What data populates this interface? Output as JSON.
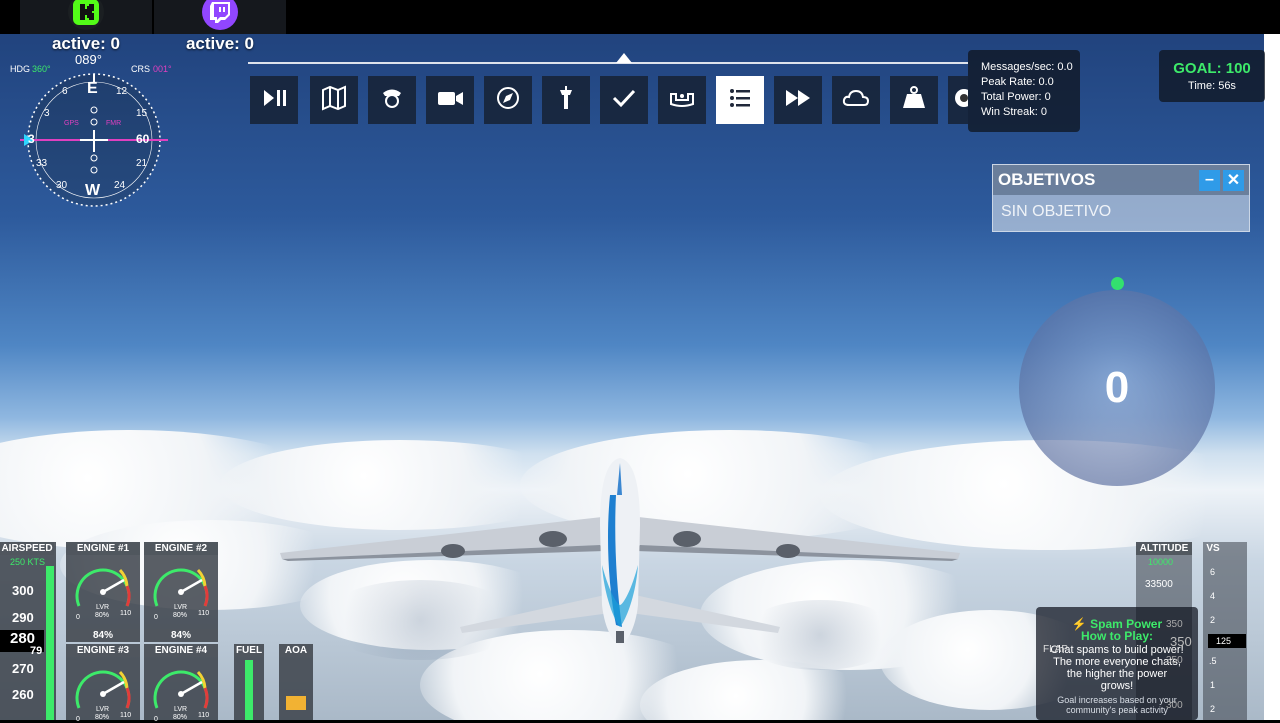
{
  "platforms": [
    {
      "name": "kick",
      "active_label": "active: 0",
      "color": "#53fc18"
    },
    {
      "name": "twitch",
      "active_label": "active: 0",
      "color": "#9146ff"
    }
  ],
  "toolbar": {
    "buttons": [
      {
        "icon": "play-pause-icon",
        "active": false
      },
      {
        "icon": "map-icon",
        "active": false
      },
      {
        "icon": "pilot-icon",
        "active": false
      },
      {
        "icon": "camera-icon",
        "active": false
      },
      {
        "icon": "compass-icon",
        "active": false
      },
      {
        "icon": "tower-icon",
        "active": false
      },
      {
        "icon": "checkmark-icon",
        "active": false
      },
      {
        "icon": "controls-icon",
        "active": false
      },
      {
        "icon": "list-icon",
        "active": true
      },
      {
        "icon": "fast-forward-icon",
        "active": false
      },
      {
        "icon": "weather-cloud-icon",
        "active": false
      },
      {
        "icon": "weight-icon",
        "active": false
      },
      {
        "icon": "gear-icon",
        "active": false
      }
    ]
  },
  "stats": {
    "messages": "Messages/sec: 0.0",
    "peak": "Peak Rate: 0.0",
    "power": "Total Power: 0",
    "streak": "Win Streak: 0"
  },
  "goal": {
    "title": "GOAL: 100",
    "time": "Time: 56s"
  },
  "objectives": {
    "title": "OBJETIVOS",
    "minimize": "–",
    "close": "✕",
    "empty": "SIN OBJETIVO"
  },
  "power_value": "0",
  "spam": {
    "title": "Spam Power",
    "subtitle": "How to Play:",
    "body": "Chat spams to build power! The more everyone chats, the higher the power grows!",
    "footer": "Goal increases based on your community's peak activity"
  },
  "compass": {
    "hdg_label": "HDG",
    "hdg_value": "360°",
    "crs_label": "CRS",
    "crs_value": "001°",
    "heading": "089°",
    "gps": "GPS",
    "fmr": "FMR",
    "marks": {
      "e": "E",
      "w": "W",
      "n12": "12",
      "n15": "15",
      "n6": "6",
      "n3": "3",
      "n33": "33",
      "n30": "30",
      "n24": "24",
      "n21": "21",
      "n60": "60",
      "n3b": "3"
    }
  },
  "instruments": {
    "airspeed": {
      "label": "AIRSPEED",
      "bug": "250 KTS",
      "ticks": [
        "300",
        "290",
        "280",
        "270",
        "260"
      ],
      "current": "280",
      "current_b": "79"
    },
    "engines": [
      {
        "label": "ENGINE #1",
        "pct": "84%",
        "lvr": "LVR",
        "lvr_pct": "80%",
        "min": "0",
        "max": "110"
      },
      {
        "label": "ENGINE #2",
        "pct": "84%",
        "lvr": "LVR",
        "lvr_pct": "80%",
        "min": "0",
        "max": "110"
      },
      {
        "label": "ENGINE #3",
        "pct": "",
        "lvr": "LVR",
        "lvr_pct": "80%",
        "min": "0",
        "max": "110"
      },
      {
        "label": "ENGINE #4",
        "pct": "",
        "lvr": "LVR",
        "lvr_pct": "80%",
        "min": "0",
        "max": "110"
      }
    ],
    "fuel": {
      "label": "FUEL"
    },
    "aoa": {
      "label": "AOA"
    },
    "altitude": {
      "label": "ALTITUDE",
      "bug": "10000",
      "tick": "33500",
      "right_a": "350",
      "right_b": "350",
      "right_c": "350",
      "right_d": "300"
    },
    "flaps": {
      "label": "FLAP"
    },
    "vs": {
      "label": "VS",
      "ticks": [
        "6",
        "4",
        "2",
        "1",
        ".5",
        "1",
        "2"
      ],
      "value": "125"
    }
  }
}
